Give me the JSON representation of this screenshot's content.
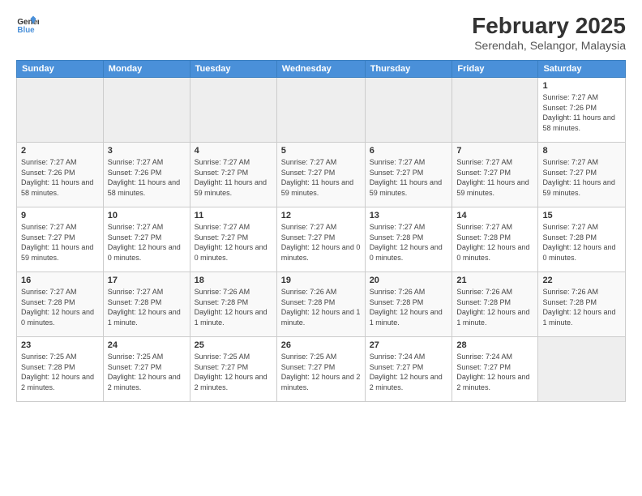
{
  "logo": {
    "text_general": "General",
    "text_blue": "Blue"
  },
  "title": "February 2025",
  "subtitle": "Serendah, Selangor, Malaysia",
  "header": {
    "days": [
      "Sunday",
      "Monday",
      "Tuesday",
      "Wednesday",
      "Thursday",
      "Friday",
      "Saturday"
    ]
  },
  "weeks": [
    [
      {
        "day": "",
        "info": "",
        "empty": true
      },
      {
        "day": "",
        "info": "",
        "empty": true
      },
      {
        "day": "",
        "info": "",
        "empty": true
      },
      {
        "day": "",
        "info": "",
        "empty": true
      },
      {
        "day": "",
        "info": "",
        "empty": true
      },
      {
        "day": "",
        "info": "",
        "empty": true
      },
      {
        "day": "1",
        "info": "Sunrise: 7:27 AM\nSunset: 7:26 PM\nDaylight: 11 hours and 58 minutes.",
        "empty": false
      }
    ],
    [
      {
        "day": "2",
        "info": "Sunrise: 7:27 AM\nSunset: 7:26 PM\nDaylight: 11 hours and 58 minutes.",
        "empty": false
      },
      {
        "day": "3",
        "info": "Sunrise: 7:27 AM\nSunset: 7:26 PM\nDaylight: 11 hours and 58 minutes.",
        "empty": false
      },
      {
        "day": "4",
        "info": "Sunrise: 7:27 AM\nSunset: 7:27 PM\nDaylight: 11 hours and 59 minutes.",
        "empty": false
      },
      {
        "day": "5",
        "info": "Sunrise: 7:27 AM\nSunset: 7:27 PM\nDaylight: 11 hours and 59 minutes.",
        "empty": false
      },
      {
        "day": "6",
        "info": "Sunrise: 7:27 AM\nSunset: 7:27 PM\nDaylight: 11 hours and 59 minutes.",
        "empty": false
      },
      {
        "day": "7",
        "info": "Sunrise: 7:27 AM\nSunset: 7:27 PM\nDaylight: 11 hours and 59 minutes.",
        "empty": false
      },
      {
        "day": "8",
        "info": "Sunrise: 7:27 AM\nSunset: 7:27 PM\nDaylight: 11 hours and 59 minutes.",
        "empty": false
      }
    ],
    [
      {
        "day": "9",
        "info": "Sunrise: 7:27 AM\nSunset: 7:27 PM\nDaylight: 11 hours and 59 minutes.",
        "empty": false
      },
      {
        "day": "10",
        "info": "Sunrise: 7:27 AM\nSunset: 7:27 PM\nDaylight: 12 hours and 0 minutes.",
        "empty": false
      },
      {
        "day": "11",
        "info": "Sunrise: 7:27 AM\nSunset: 7:27 PM\nDaylight: 12 hours and 0 minutes.",
        "empty": false
      },
      {
        "day": "12",
        "info": "Sunrise: 7:27 AM\nSunset: 7:27 PM\nDaylight: 12 hours and 0 minutes.",
        "empty": false
      },
      {
        "day": "13",
        "info": "Sunrise: 7:27 AM\nSunset: 7:28 PM\nDaylight: 12 hours and 0 minutes.",
        "empty": false
      },
      {
        "day": "14",
        "info": "Sunrise: 7:27 AM\nSunset: 7:28 PM\nDaylight: 12 hours and 0 minutes.",
        "empty": false
      },
      {
        "day": "15",
        "info": "Sunrise: 7:27 AM\nSunset: 7:28 PM\nDaylight: 12 hours and 0 minutes.",
        "empty": false
      }
    ],
    [
      {
        "day": "16",
        "info": "Sunrise: 7:27 AM\nSunset: 7:28 PM\nDaylight: 12 hours and 0 minutes.",
        "empty": false
      },
      {
        "day": "17",
        "info": "Sunrise: 7:27 AM\nSunset: 7:28 PM\nDaylight: 12 hours and 1 minute.",
        "empty": false
      },
      {
        "day": "18",
        "info": "Sunrise: 7:26 AM\nSunset: 7:28 PM\nDaylight: 12 hours and 1 minute.",
        "empty": false
      },
      {
        "day": "19",
        "info": "Sunrise: 7:26 AM\nSunset: 7:28 PM\nDaylight: 12 hours and 1 minute.",
        "empty": false
      },
      {
        "day": "20",
        "info": "Sunrise: 7:26 AM\nSunset: 7:28 PM\nDaylight: 12 hours and 1 minute.",
        "empty": false
      },
      {
        "day": "21",
        "info": "Sunrise: 7:26 AM\nSunset: 7:28 PM\nDaylight: 12 hours and 1 minute.",
        "empty": false
      },
      {
        "day": "22",
        "info": "Sunrise: 7:26 AM\nSunset: 7:28 PM\nDaylight: 12 hours and 1 minute.",
        "empty": false
      }
    ],
    [
      {
        "day": "23",
        "info": "Sunrise: 7:25 AM\nSunset: 7:28 PM\nDaylight: 12 hours and 2 minutes.",
        "empty": false
      },
      {
        "day": "24",
        "info": "Sunrise: 7:25 AM\nSunset: 7:27 PM\nDaylight: 12 hours and 2 minutes.",
        "empty": false
      },
      {
        "day": "25",
        "info": "Sunrise: 7:25 AM\nSunset: 7:27 PM\nDaylight: 12 hours and 2 minutes.",
        "empty": false
      },
      {
        "day": "26",
        "info": "Sunrise: 7:25 AM\nSunset: 7:27 PM\nDaylight: 12 hours and 2 minutes.",
        "empty": false
      },
      {
        "day": "27",
        "info": "Sunrise: 7:24 AM\nSunset: 7:27 PM\nDaylight: 12 hours and 2 minutes.",
        "empty": false
      },
      {
        "day": "28",
        "info": "Sunrise: 7:24 AM\nSunset: 7:27 PM\nDaylight: 12 hours and 2 minutes.",
        "empty": false
      },
      {
        "day": "",
        "info": "",
        "empty": true
      }
    ]
  ]
}
